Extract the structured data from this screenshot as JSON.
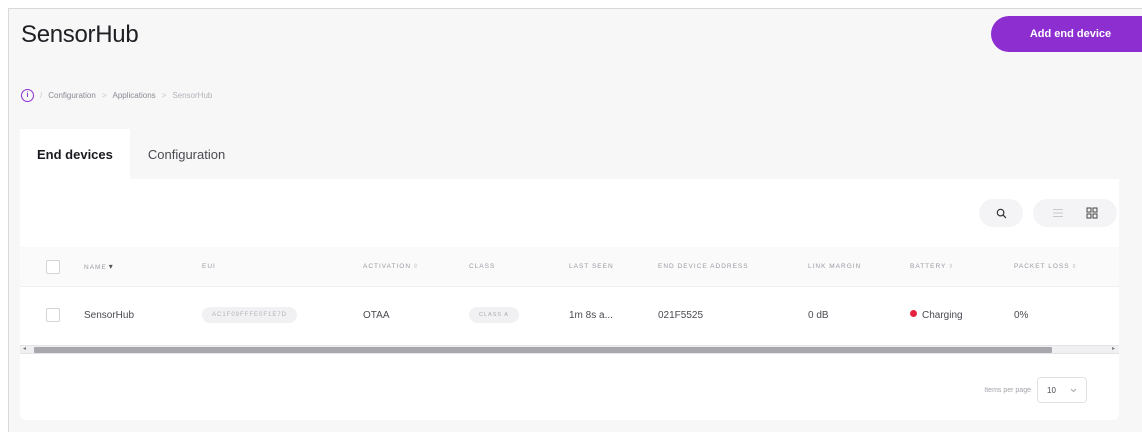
{
  "app": {
    "title": "SensorHub"
  },
  "header": {
    "add_button_label": "Add end device"
  },
  "breadcrumb": {
    "icon": "info-icon",
    "items": [
      "Configuration",
      "Applications",
      "SensorHub"
    ]
  },
  "tabs": [
    {
      "label": "End devices",
      "active": true
    },
    {
      "label": "Configuration",
      "active": false
    }
  ],
  "toolbar": {
    "search_icon": "search-icon",
    "list_view_icon": "list-view-icon",
    "grid_view_icon": "grid-view-icon"
  },
  "table": {
    "columns": [
      {
        "key": "name",
        "label": "NAME",
        "sort": "▾"
      },
      {
        "key": "eui",
        "label": "EUI",
        "sort": ""
      },
      {
        "key": "activation",
        "label": "ACTIVATION",
        "sort": "⇳"
      },
      {
        "key": "class",
        "label": "CLASS",
        "sort": ""
      },
      {
        "key": "last_seen",
        "label": "LAST SEEN",
        "sort": ""
      },
      {
        "key": "address",
        "label": "END DEVICE ADDRESS",
        "sort": ""
      },
      {
        "key": "link_margin",
        "label": "LINK MARGIN",
        "sort": ""
      },
      {
        "key": "battery",
        "label": "BATTERY",
        "sort": "⇳"
      },
      {
        "key": "packet_loss",
        "label": "PACKET LOSS",
        "sort": "⇳"
      }
    ],
    "rows": [
      {
        "name": "SensorHub",
        "eui": "AC1F09FFFE0F1E7D",
        "activation": "OTAA",
        "class": "CLASS A",
        "last_seen": "1m 8s a...",
        "address": "021F5525",
        "link_margin": "0 dB",
        "battery": "Charging",
        "battery_status_color": "#e6243f",
        "packet_loss": "0%"
      }
    ]
  },
  "scrollbar": {
    "left_arrow": "◂",
    "right_arrow": "▸"
  },
  "pagination": {
    "items_per_page_label": "Items per page",
    "items_per_page_value": "10",
    "dropdown_icon": "chevron-down-icon"
  },
  "colors": {
    "accent": "#8c2ed0",
    "status_red": "#e6243f"
  }
}
